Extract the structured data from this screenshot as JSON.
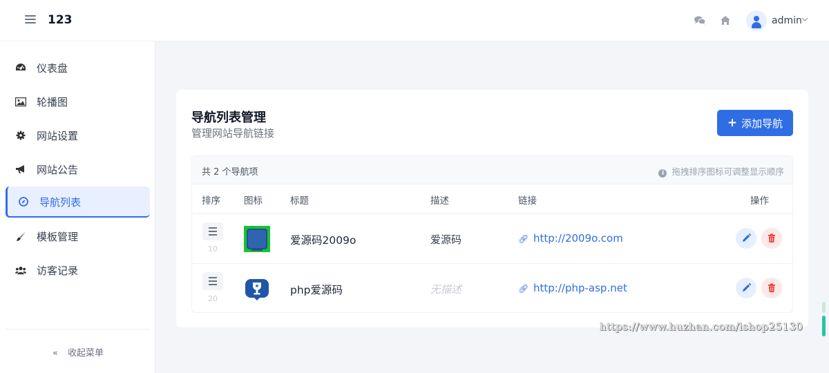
{
  "header": {
    "brand": "123",
    "user_name": "admin"
  },
  "sidebar": {
    "items": [
      {
        "label": "仪表盘",
        "icon": "dashboard-icon"
      },
      {
        "label": "轮播图",
        "icon": "image-icon"
      },
      {
        "label": "网站设置",
        "icon": "gear-icon"
      },
      {
        "label": "网站公告",
        "icon": "megaphone-icon"
      },
      {
        "label": "导航列表",
        "icon": "compass-icon",
        "active": true
      },
      {
        "label": "模板管理",
        "icon": "brush-icon"
      },
      {
        "label": "访客记录",
        "icon": "users-icon"
      }
    ],
    "collapse_label": "收起菜单"
  },
  "main": {
    "title": "导航列表管理",
    "subtitle": "管理网站导航链接",
    "add_button": "添加导航",
    "count_text": "共 2 个导航项",
    "hint_text": "拖拽排序图标可调整显示顺序",
    "columns": [
      "排序",
      "图标",
      "标题",
      "描述",
      "链接",
      "操作"
    ],
    "rows": [
      {
        "sort": "10",
        "title": "爱源码2009o",
        "description": "爱源码",
        "link": "http://2009o.com"
      },
      {
        "sort": "20",
        "title": "php爱源码",
        "description": "无描述",
        "description_empty": true,
        "link": "http://php-asp.net"
      }
    ]
  },
  "watermark": "https://www.huzhan.com/ishop25130",
  "colors": {
    "accent": "#2f6de5",
    "danger": "#e53935",
    "active_bg": "#e8efff"
  }
}
